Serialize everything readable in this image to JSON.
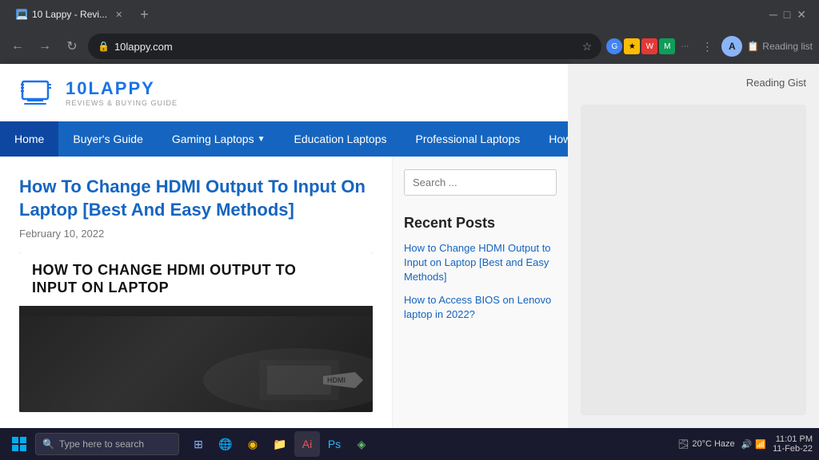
{
  "browser": {
    "tab_title": "10 Lappy - Revi...",
    "tab_favicon": "🖥",
    "address": "10lappy.com",
    "reading_list_label": "Reading list"
  },
  "site": {
    "logo_name": "10LAPPY",
    "logo_tagline": "REVIEWS & BUYING GUIDE",
    "nav": [
      {
        "label": "Home",
        "active": true
      },
      {
        "label": "Buyer's Guide",
        "active": false
      },
      {
        "label": "Gaming Laptops",
        "active": false,
        "has_arrow": true
      },
      {
        "label": "Education Laptops",
        "active": false
      },
      {
        "label": "Professional Laptops",
        "active": false
      },
      {
        "label": "How To",
        "active": false
      }
    ],
    "article": {
      "title": "How To Change HDMI Output To Input On Laptop [Best And Easy Methods]",
      "date": "February 10, 2022",
      "image_headline_line1": "HOW TO CHANGE HDMI OUTPUT TO",
      "image_headline_line2": "INPUT ON LAPTOP"
    }
  },
  "sidebar": {
    "search_placeholder": "Search ...",
    "recent_posts_title": "Recent Posts",
    "recent_posts": [
      {
        "text": "How to Change HDMI Output to Input on Laptop [Best and Easy Methods]"
      },
      {
        "text": "How to Access BIOS on Lenovo laptop in 2022?"
      }
    ]
  },
  "right_panel": {
    "reading_gist_label": "Reading Gist"
  },
  "taskbar": {
    "search_placeholder": "Type here to search",
    "weather": "20°C  Haze",
    "time": "11:01 PM",
    "date": "11-Feb-22"
  }
}
